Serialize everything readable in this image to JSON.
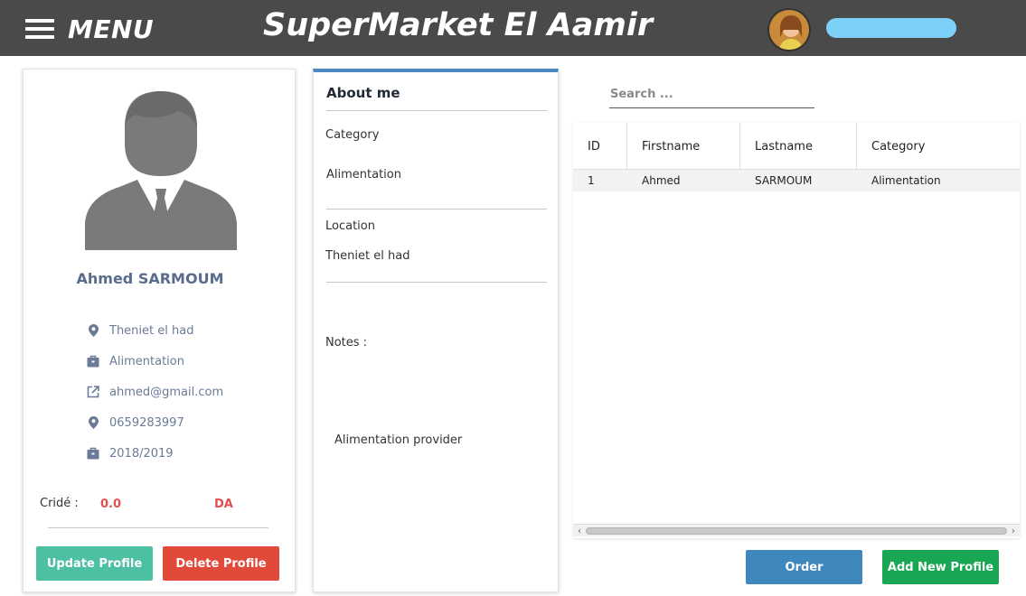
{
  "header": {
    "menu_label": "MENU",
    "app_title": "SuperMarket El Aamir"
  },
  "profile": {
    "name": "Ahmed SARMOUM",
    "info": [
      {
        "icon": "location-pin-icon",
        "text": "Theniet el had"
      },
      {
        "icon": "briefcase-icon",
        "text": "Alimentation"
      },
      {
        "icon": "external-link-icon",
        "text": "ahmed@gmail.com"
      },
      {
        "icon": "location-pin-icon",
        "text": "0659283997"
      },
      {
        "icon": "briefcase-icon",
        "text": "2018/2019"
      }
    ],
    "credit_label": "Cridé :",
    "credit_value": "0.0",
    "credit_unit": "DA",
    "update_button": "Update Profile",
    "delete_button": "Delete Profile"
  },
  "about": {
    "title": "About me",
    "category_label": "Category",
    "category_value": "Alimentation",
    "location_label": "Location",
    "location_value": "Theniet el had",
    "notes_label": "Notes :",
    "notes_value": "Alimentation provider"
  },
  "search": {
    "placeholder": "Search ..."
  },
  "table": {
    "columns": [
      "ID",
      "Firstname",
      "Lastname",
      "Category"
    ],
    "rows": [
      [
        "1",
        "Ahmed",
        "SARMOUM",
        "Alimentation"
      ]
    ]
  },
  "actions": {
    "order_button": "Order",
    "add_button": "Add New Profile"
  },
  "colors": {
    "header_bg": "#4a4a4a",
    "update": "#4dc0a3",
    "delete": "#e14a3b",
    "order": "#3f88be",
    "add": "#1aa753",
    "credit": "#e05050"
  }
}
